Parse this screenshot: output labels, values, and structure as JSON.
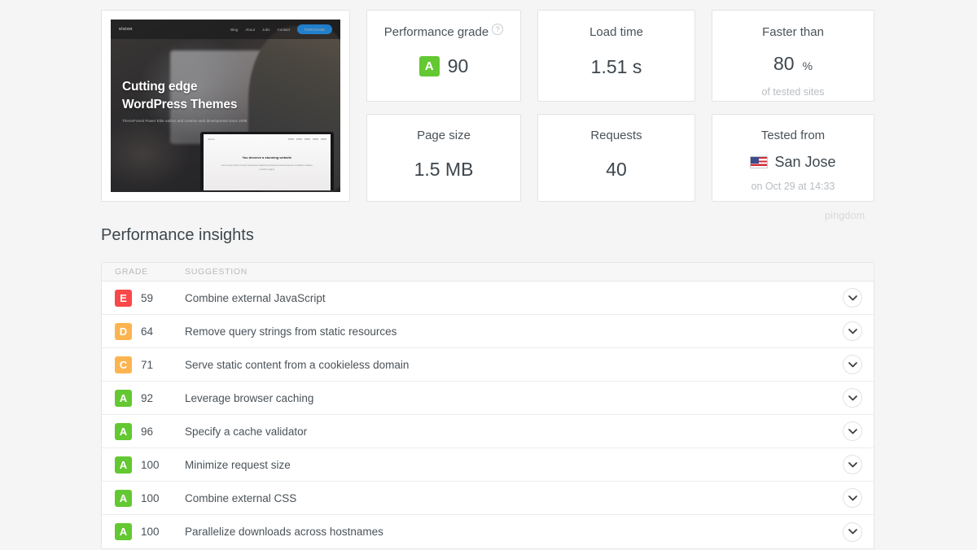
{
  "thumbnail": {
    "logo": "vision",
    "nav": [
      "Blog",
      "About",
      "Jobs",
      "Contact"
    ],
    "cta": "PURCHASE",
    "heading_line1": "Cutting edge",
    "heading_line2": "WordPress Themes",
    "subheading": "ThemeForest Power Elite author and creative web development since 2008",
    "device_title": "You deserve a stunning website",
    "device_body": "Lorem ipsum dolor sit amet consectetur adipiscing elit sed do eiusmod tempor incididunt ut labore et dolore magna"
  },
  "stats": {
    "grade": {
      "label": "Performance grade",
      "help_icon": "question-circle-icon",
      "badge": "A",
      "value": "90",
      "color": "#63c832"
    },
    "load_time": {
      "label": "Load time",
      "value": "1.51 s"
    },
    "faster_than": {
      "label": "Faster than",
      "value": "80",
      "unit": "%",
      "sub": "of tested sites"
    },
    "page_size": {
      "label": "Page size",
      "value": "1.5 MB"
    },
    "requests": {
      "label": "Requests",
      "value": "40"
    },
    "tested_from": {
      "label": "Tested from",
      "flag_icon": "us-flag-icon",
      "value": "San Jose",
      "sub": "on Oct 29 at 14:33"
    }
  },
  "watermark": "pingdom",
  "insights": {
    "title": "Performance insights",
    "columns": {
      "grade": "GRADE",
      "suggestion": "SUGGESTION"
    },
    "expand_icon": "chevron-down-icon",
    "grade_colors": {
      "A": "#63c832",
      "C": "#fcb450",
      "D": "#fcb450",
      "E": "#f9484a"
    },
    "rows": [
      {
        "grade": "E",
        "color": "#f9484a",
        "score": "59",
        "suggestion": "Combine external JavaScript"
      },
      {
        "grade": "D",
        "color": "#fcb450",
        "score": "64",
        "suggestion": "Remove query strings from static resources"
      },
      {
        "grade": "C",
        "color": "#fcb450",
        "score": "71",
        "suggestion": "Serve static content from a cookieless domain"
      },
      {
        "grade": "A",
        "color": "#63c832",
        "score": "92",
        "suggestion": "Leverage browser caching"
      },
      {
        "grade": "A",
        "color": "#63c832",
        "score": "96",
        "suggestion": "Specify a cache validator"
      },
      {
        "grade": "A",
        "color": "#63c832",
        "score": "100",
        "suggestion": "Minimize request size"
      },
      {
        "grade": "A",
        "color": "#63c832",
        "score": "100",
        "suggestion": "Combine external CSS"
      },
      {
        "grade": "A",
        "color": "#63c832",
        "score": "100",
        "suggestion": "Parallelize downloads across hostnames"
      }
    ]
  }
}
